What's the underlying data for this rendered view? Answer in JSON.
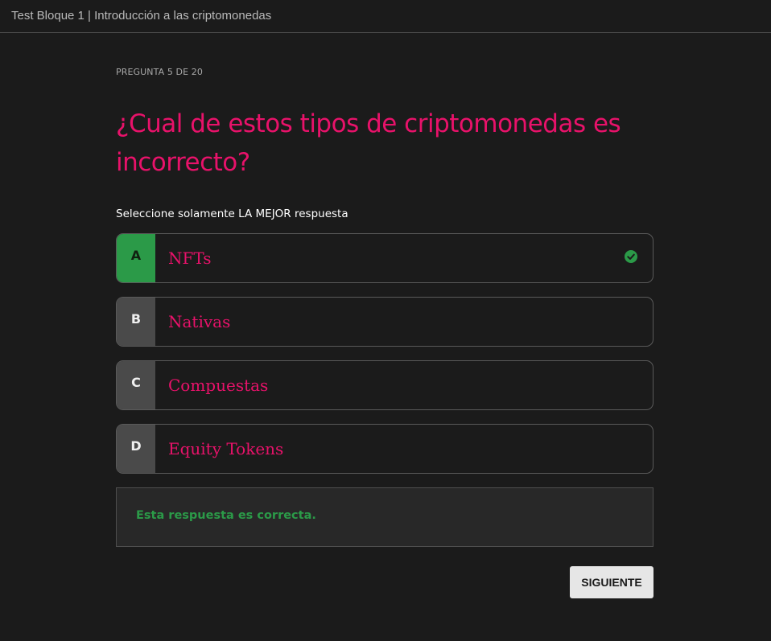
{
  "header": {
    "title": "Test Bloque 1 | Introducción a las criptomonedas"
  },
  "quiz": {
    "counter": "PREGUNTA 5 DE 20",
    "question": "¿Cual de estos tipos de criptomonedas es incorrecto?",
    "instruction": "Seleccione solamente LA MEJOR respuesta",
    "options": [
      {
        "letter": "A",
        "text": "NFTs",
        "selected": true
      },
      {
        "letter": "B",
        "text": "Nativas",
        "selected": false
      },
      {
        "letter": "C",
        "text": "Compuestas",
        "selected": false
      },
      {
        "letter": "D",
        "text": "Equity Tokens",
        "selected": false
      }
    ],
    "selected_icon": "check-circle-icon",
    "feedback": "Esta respuesta es correcta.",
    "next_label": "SIGUIENTE"
  },
  "colors": {
    "accent": "#e8126a",
    "correct": "#2b9a48",
    "background": "#1b1b1b"
  }
}
